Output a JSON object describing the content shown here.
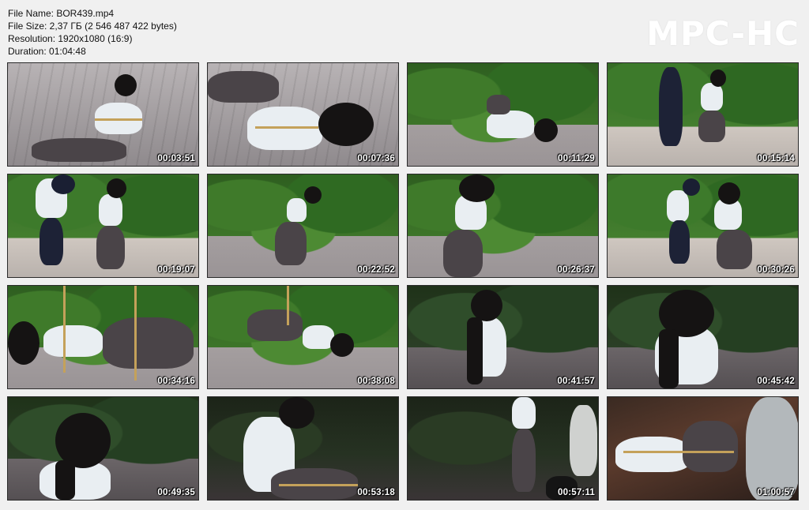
{
  "info": {
    "file_name": "File Name: BOR439.mp4",
    "file_size": "File Size: 2,37 ГБ (2 546 487 422 bytes)",
    "resolution": "Resolution: 1920x1080 (16:9)",
    "duration": "Duration: 01:04:48"
  },
  "logo": "MPC-HC",
  "thumbnails": [
    {
      "timestamp": "00:03:51"
    },
    {
      "timestamp": "00:07:36"
    },
    {
      "timestamp": "00:11:29"
    },
    {
      "timestamp": "00:15:14"
    },
    {
      "timestamp": "00:19:07"
    },
    {
      "timestamp": "00:22:52"
    },
    {
      "timestamp": "00:26:37"
    },
    {
      "timestamp": "00:30:26"
    },
    {
      "timestamp": "00:34:16"
    },
    {
      "timestamp": "00:38:08"
    },
    {
      "timestamp": "00:41:57"
    },
    {
      "timestamp": "00:45:42"
    },
    {
      "timestamp": "00:49:35"
    },
    {
      "timestamp": "00:53:18"
    },
    {
      "timestamp": "00:57:11"
    },
    {
      "timestamp": "01:00:57"
    }
  ]
}
